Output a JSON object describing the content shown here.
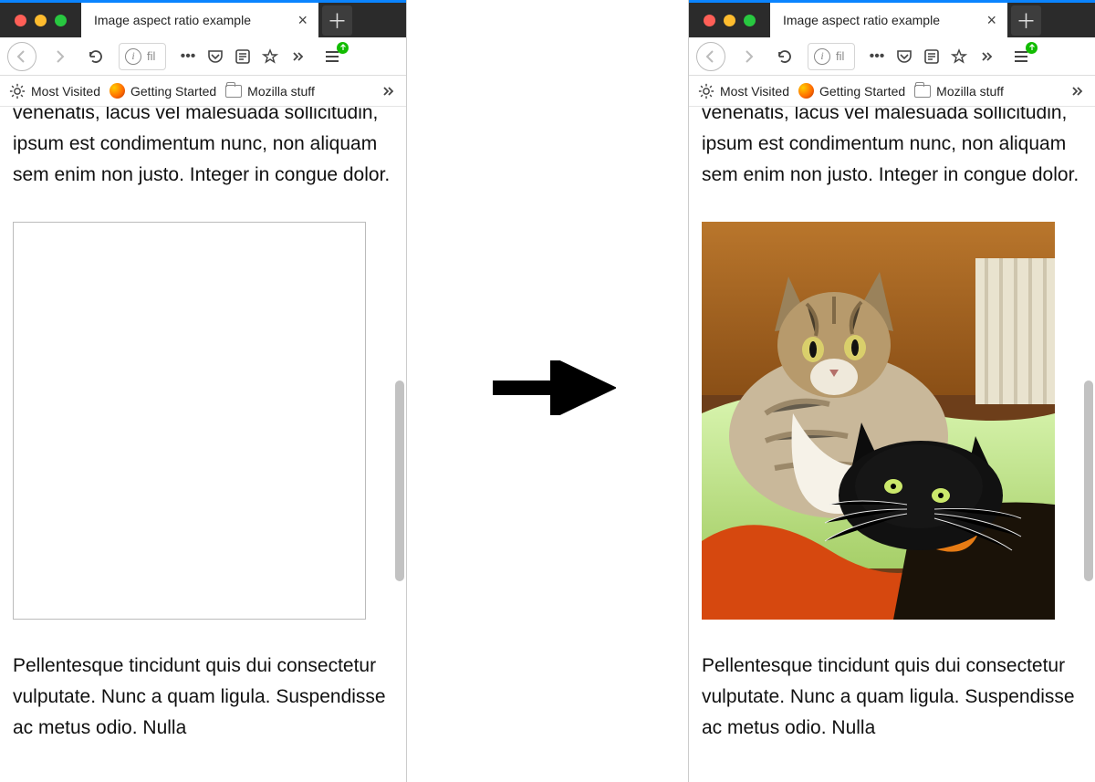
{
  "tab": {
    "title": "Image aspect ratio example"
  },
  "urlbar": {
    "text": "fil"
  },
  "bookmarks": {
    "most_visited": "Most Visited",
    "getting_started": "Getting Started",
    "mozilla_stuff": "Mozilla stuff"
  },
  "content": {
    "para_top_fragment": "venenatis, lacus vel malesuada sollicitudin, ipsum est condimentum nunc, non aliquam sem enim non justo. Integer in congue dolor.",
    "para_bottom_fragment": "Pellentesque tincidunt quis dui consectetur vulputate. Nunc a quam ligula. Suspendisse ac metus odio. Nulla"
  }
}
